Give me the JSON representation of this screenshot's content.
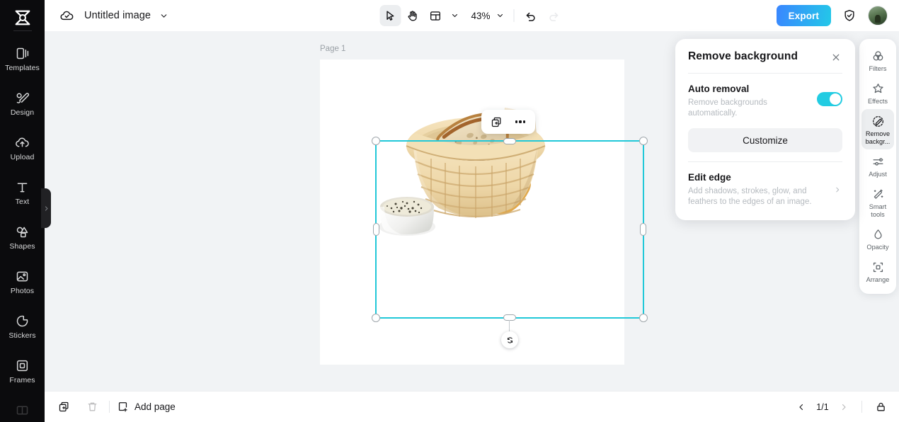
{
  "app": {
    "logo_icon": "capcut-logo-icon"
  },
  "topbar": {
    "cloud_icon": "cloud-saved-icon",
    "doc_title": "Untitled image",
    "title_caret_icon": "chevron-down-icon",
    "tools": {
      "select_icon": "cursor-select-icon",
      "hand_icon": "hand-pan-icon",
      "layout_icon": "layout-grid-icon",
      "layout_caret_icon": "chevron-down-icon",
      "zoom_value": "43%",
      "zoom_caret_icon": "chevron-down-icon",
      "undo_icon": "undo-arrow-icon",
      "redo_icon": "redo-arrow-icon"
    },
    "export_label": "Export",
    "shield_icon": "shield-check-icon",
    "avatar_name": "user-avatar"
  },
  "canvas": {
    "page_label": "Page 1",
    "float_toolbar": {
      "duplicate_icon": "duplicate-layer-icon",
      "more_icon": "more-options-icon"
    },
    "rotate_icon": "rotate-handle-icon",
    "selection_color": "#21c8d8"
  },
  "remove_bg_panel": {
    "title": "Remove background",
    "close_icon": "close-icon",
    "auto_removal": {
      "title": "Auto removal",
      "description": "Remove backgrounds automatically.",
      "toggle_on": true,
      "toggle_color": "#22cce2"
    },
    "customize_label": "Customize",
    "edit_edge": {
      "title": "Edit edge",
      "description": "Add shadows, strokes, glow, and feathers to the edges of an image.",
      "chevron_icon": "chevron-right-icon"
    }
  },
  "left_sidebar": {
    "items": [
      {
        "label": "Templates",
        "icon": "templates-icon"
      },
      {
        "label": "Design",
        "icon": "design-brush-icon"
      },
      {
        "label": "Upload",
        "icon": "upload-cloud-icon"
      },
      {
        "label": "Text",
        "icon": "text-icon"
      },
      {
        "label": "Shapes",
        "icon": "shapes-icon"
      },
      {
        "label": "Photos",
        "icon": "photos-icon"
      },
      {
        "label": "Stickers",
        "icon": "stickers-icon"
      },
      {
        "label": "Frames",
        "icon": "frames-icon"
      }
    ],
    "collapse_icon": "chevron-right-icon"
  },
  "right_rail": {
    "items": [
      {
        "label": "Filters",
        "icon": "filters-icon",
        "active": false
      },
      {
        "label": "Effects",
        "icon": "effects-star-icon",
        "active": false
      },
      {
        "label": "Remove backgr...",
        "icon": "remove-background-icon",
        "active": true
      },
      {
        "label": "Adjust",
        "icon": "adjust-sliders-icon",
        "active": false
      },
      {
        "label": "Smart tools",
        "icon": "smart-tools-icon",
        "active": false
      },
      {
        "label": "Opacity",
        "icon": "opacity-drop-icon",
        "active": false
      },
      {
        "label": "Arrange",
        "icon": "arrange-icon",
        "active": false
      }
    ]
  },
  "bottombar": {
    "duplicate_page_icon": "duplicate-page-icon",
    "delete_icon": "trash-delete-icon",
    "add_page_label": "Add page",
    "add_page_icon": "add-page-icon",
    "prev_icon": "chevron-left-icon",
    "page_indicator": "1/1",
    "next_icon": "chevron-right-icon",
    "lock_icon": "lock-icon"
  }
}
